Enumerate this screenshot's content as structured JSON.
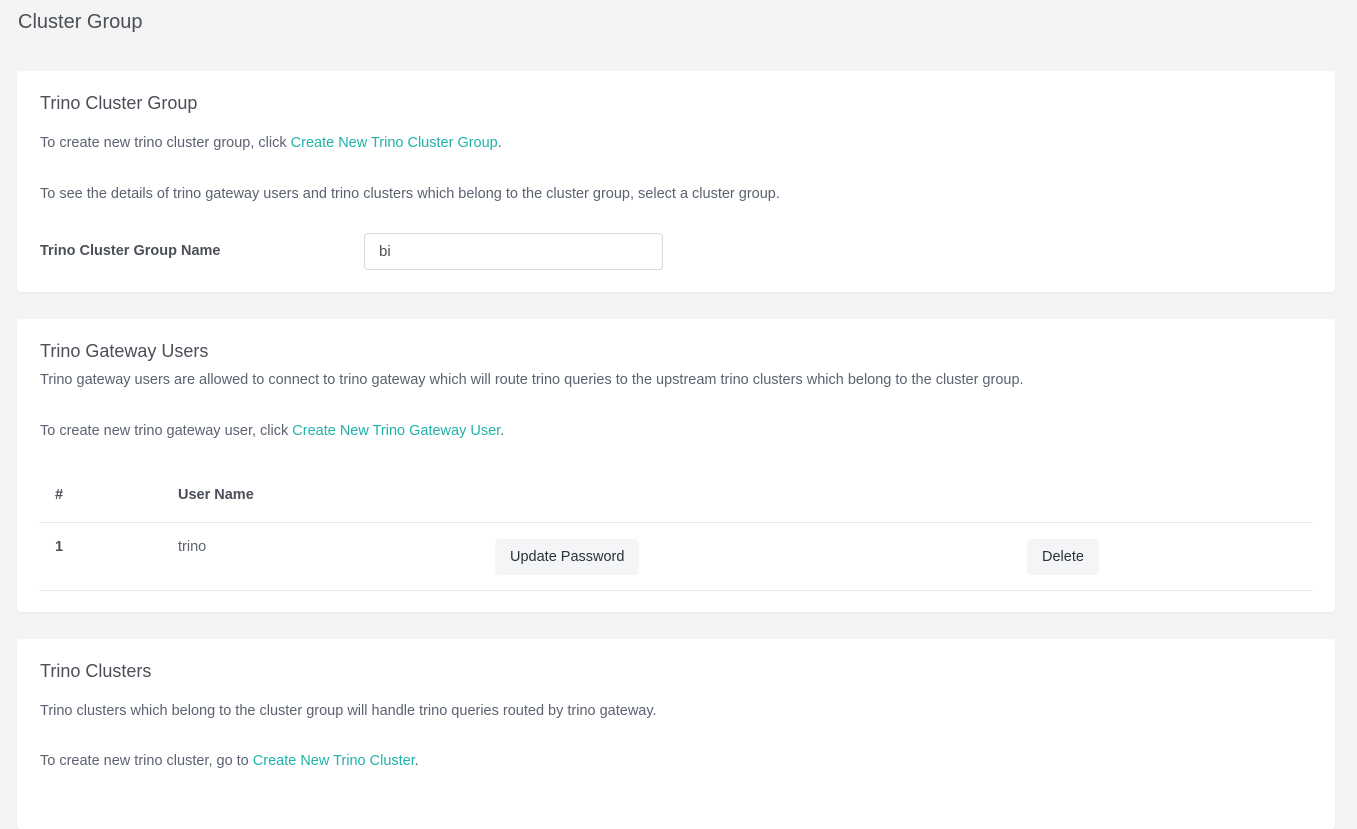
{
  "page": {
    "title": "Cluster Group"
  },
  "cluster_group_card": {
    "title": "Trino Cluster Group",
    "create_text_prefix": "To create new trino cluster group, click ",
    "create_link": "Create New Trino Cluster Group",
    "create_text_suffix": ".",
    "details_text": "To see the details of trino gateway users and trino clusters which belong to the cluster group, select a cluster group.",
    "field_label": "Trino Cluster Group Name",
    "field_value": "bi"
  },
  "gateway_users_card": {
    "title": "Trino Gateway Users",
    "description": "Trino gateway users are allowed to connect to trino gateway which will route trino queries to the upstream trino clusters which belong to the cluster group.",
    "create_text_prefix": "To create new trino gateway user, click ",
    "create_link": "Create New Trino Gateway User",
    "create_text_suffix": ".",
    "table": {
      "columns": [
        "#",
        "User Name"
      ],
      "rows": [
        {
          "index": "1",
          "user_name": "trino",
          "update_label": "Update Password",
          "delete_label": "Delete"
        }
      ]
    }
  },
  "clusters_card": {
    "title": "Trino Clusters",
    "description": "Trino clusters which belong to the cluster group will handle trino queries routed by trino gateway.",
    "create_text_prefix": "To create new trino cluster, go to ",
    "create_link": "Create New Trino Cluster",
    "create_text_suffix": "."
  },
  "colors": {
    "link": "#20b2aa",
    "background": "#f4f4f4",
    "card": "#ffffff"
  }
}
